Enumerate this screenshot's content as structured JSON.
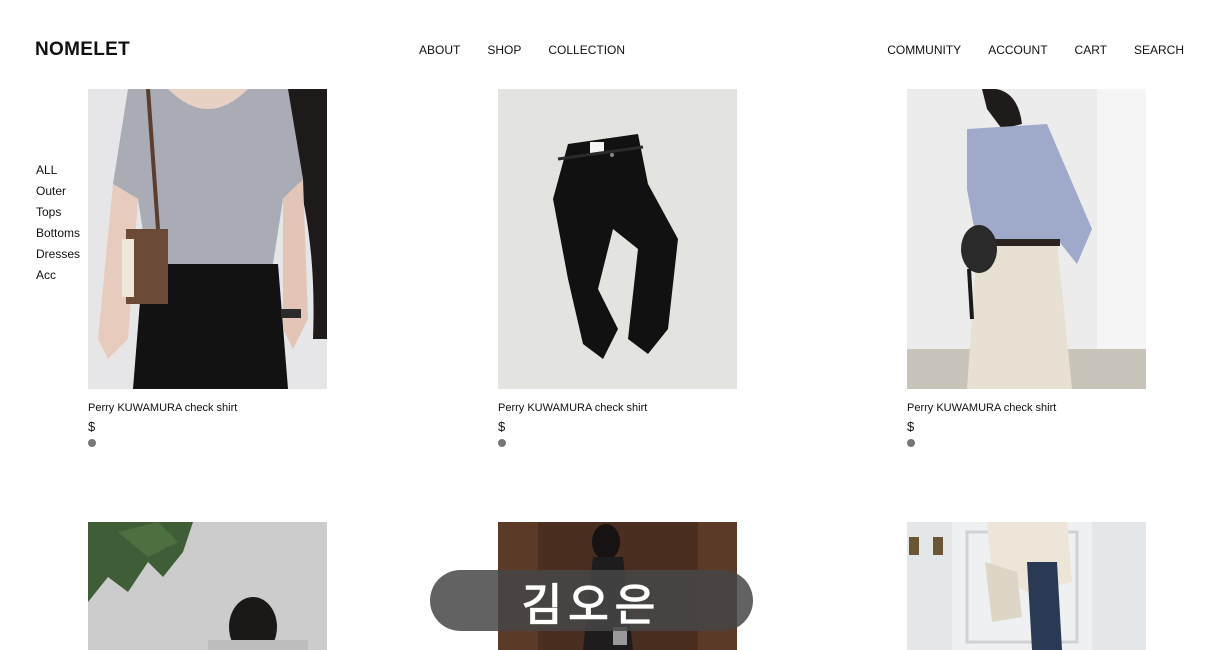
{
  "brand": {
    "logo": "NOMELET"
  },
  "nav": {
    "center": [
      "ABOUT",
      "SHOP",
      "COLLECTION"
    ],
    "right": [
      "COMMUNITY",
      "ACCOUNT",
      "CART",
      "SEARCH"
    ]
  },
  "sidebar": {
    "items": [
      "ALL",
      "Outer",
      "Tops",
      "Bottoms",
      "Dresses",
      "Acc"
    ]
  },
  "products": [
    {
      "name": "Perry KUWAMURA check shirt",
      "price": "$"
    },
    {
      "name": "Perry KUWAMURA check shirt",
      "price": "$"
    },
    {
      "name": "Perry KUWAMURA check shirt",
      "price": "$"
    }
  ],
  "overlay": {
    "text": "김오은"
  },
  "colors": {
    "text": "#111111",
    "dot": "#777777",
    "overlay_bg": "#464646"
  }
}
